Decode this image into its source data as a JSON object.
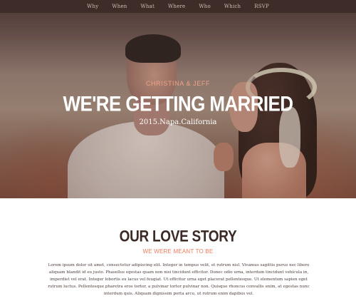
{
  "nav": {
    "items": [
      "Why",
      "When",
      "What",
      "Where",
      "Who",
      "Which",
      "RSVP"
    ]
  },
  "hero": {
    "couple": "CHRISTINA & JEFF",
    "headline": "WE'RE GETTING MARRIED",
    "subtitle": "2015.Napa.California"
  },
  "story": {
    "title": "OUR LOVE STORY",
    "subtitle": "WE WERE MEANT TO BE",
    "body": "Lorem ipsum dolor sit amet, consectetur adipiscing elit. Integer in tempus velit, et rutrum nisl. Vivamus sagittis purus nec libero aliquam blandit id eu justo. Phasellus egestas quam non nisi tincidunt efficitur. Donec odio urna, interdum tincidunt vehicula in, imperdiet vel erat. Integer lobortis eu lacus vel feugiat. Ut efficitur urna eget placerat pellentesque. Ut elementum sapien eget rutrum luctus. Pellentesque pharetra eros tortor, a pulvinar tortor pulvinar non. Quisque rhoncus convallis enim, at egestas nunc interdum quis. Aliquam dignissim porta arcu, ut rutrum enim dapibus vel."
  },
  "colors": {
    "nav_bg": "#3d2c28",
    "accent": "#ee7c61",
    "heading": "#3b2a26"
  }
}
